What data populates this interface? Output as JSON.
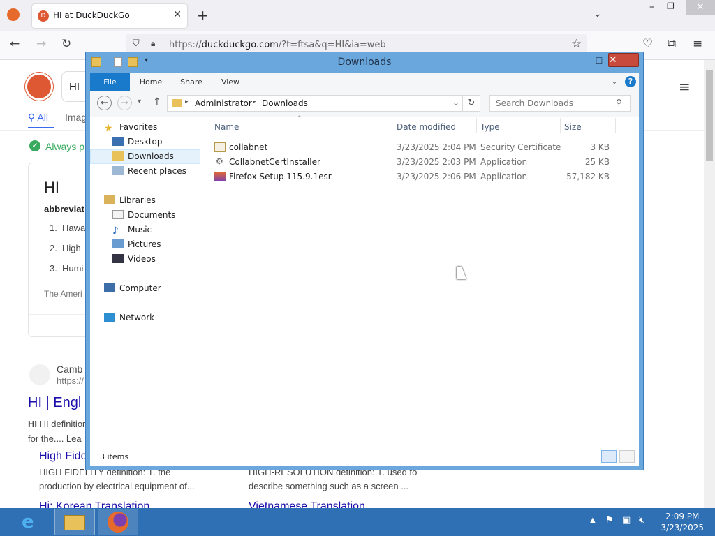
{
  "browser": {
    "tab_title": "HI at DuckDuckGo",
    "url_prefix": "https://",
    "url_domain": "duckduckgo.com",
    "url_rest": "/?t=ftsa&q=HI&ia=web"
  },
  "ddg": {
    "search_value": "HI",
    "tab_all": "All",
    "tab_images": "Imag",
    "always_private": "Always p",
    "answer_title": "HI",
    "abbrev": "abbreviat",
    "list": [
      "Hawa",
      "High",
      "Humi"
    ],
    "list_nums": [
      "1.",
      "2.",
      "3."
    ],
    "source_note": "The Ameri",
    "result_site": "Camb",
    "result_url": "https://",
    "result_title": "HI | Engl",
    "result_snippet1": "HI definition:",
    "result_snippet2": "for the.... Lea",
    "sub1_title": "High Fide",
    "sub1_line1": "HIGH FIDELITY definition: 1. the",
    "sub1_line2": "production by electrical equipment of...",
    "sub2_line1": "HIGH-RESOLUTION definition: 1. used to",
    "sub2_line2": "describe something such as a screen ...",
    "sub3_title": "Hi: Korean Translation",
    "sub4_title": "Vietnamese Translation"
  },
  "explorer": {
    "title": "Downloads",
    "ribbon_tabs": [
      "File",
      "Home",
      "Share",
      "View"
    ],
    "breadcrumb": [
      "Administrator",
      "Downloads"
    ],
    "search_placeholder": "Search Downloads",
    "nav": {
      "favorites": "Favorites",
      "desktop": "Desktop",
      "downloads": "Downloads",
      "recent": "Recent places",
      "libraries": "Libraries",
      "documents": "Documents",
      "music": "Music",
      "pictures": "Pictures",
      "videos": "Videos",
      "computer": "Computer",
      "network": "Network"
    },
    "columns": {
      "name": "Name",
      "date": "Date modified",
      "type": "Type",
      "size": "Size"
    },
    "files": [
      {
        "name": "collabnet",
        "date": "3/23/2025 2:04 PM",
        "type": "Security Certificate",
        "size": "3 KB"
      },
      {
        "name": "CollabnetCertInstaller",
        "date": "3/23/2025 2:03 PM",
        "type": "Application",
        "size": "25 KB"
      },
      {
        "name": "Firefox Setup 115.9.1esr",
        "date": "3/23/2025 2:06 PM",
        "type": "Application",
        "size": "57,182 KB"
      }
    ],
    "status": "3 items"
  },
  "taskbar": {
    "time": "2:09 PM",
    "date": "3/23/2025"
  },
  "colors": {
    "ribbon_file": "#1979ca",
    "window_frame": "#6aa7dc",
    "taskbar": "#2f6fb3",
    "link": "#1a0dab",
    "ddg_orange": "#de5833"
  }
}
